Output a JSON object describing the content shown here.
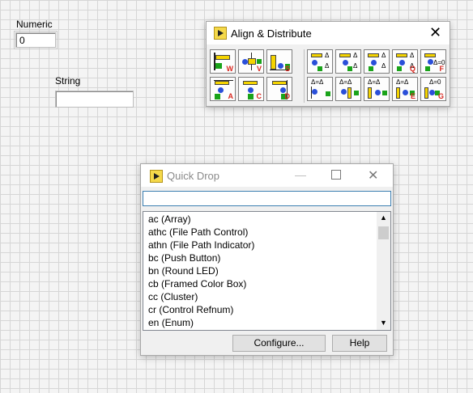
{
  "front_panel": {
    "numeric": {
      "label": "Numeric",
      "value": "0"
    },
    "string": {
      "label": "String",
      "value": ""
    }
  },
  "align_distribute": {
    "title": "Align & Distribute",
    "align_tools": [
      {
        "letter": "W"
      },
      {
        "letter": "V"
      },
      {
        "letter": "S"
      },
      {
        "letter": "A"
      },
      {
        "letter": "C"
      },
      {
        "letter": "D"
      }
    ],
    "distribute_tools": [
      {
        "letter": ""
      },
      {
        "letter": ""
      },
      {
        "letter": ""
      },
      {
        "letter": "Q"
      },
      {
        "letter": "F"
      },
      {
        "letter": ""
      },
      {
        "letter": ""
      },
      {
        "letter": ""
      },
      {
        "letter": "E"
      },
      {
        "letter": "G"
      }
    ]
  },
  "quick_drop": {
    "title": "Quick Drop",
    "search_value": "",
    "items": [
      "ac (Array)",
      "athc (File Path Control)",
      "athn (File Path Indicator)",
      "bc (Push Button)",
      "bn (Round LED)",
      "cb (Framed Color Box)",
      "cc (Cluster)",
      "cr (Control Refnum)",
      "en (Enum)"
    ],
    "configure_label": "Configure...",
    "help_label": "Help"
  }
}
